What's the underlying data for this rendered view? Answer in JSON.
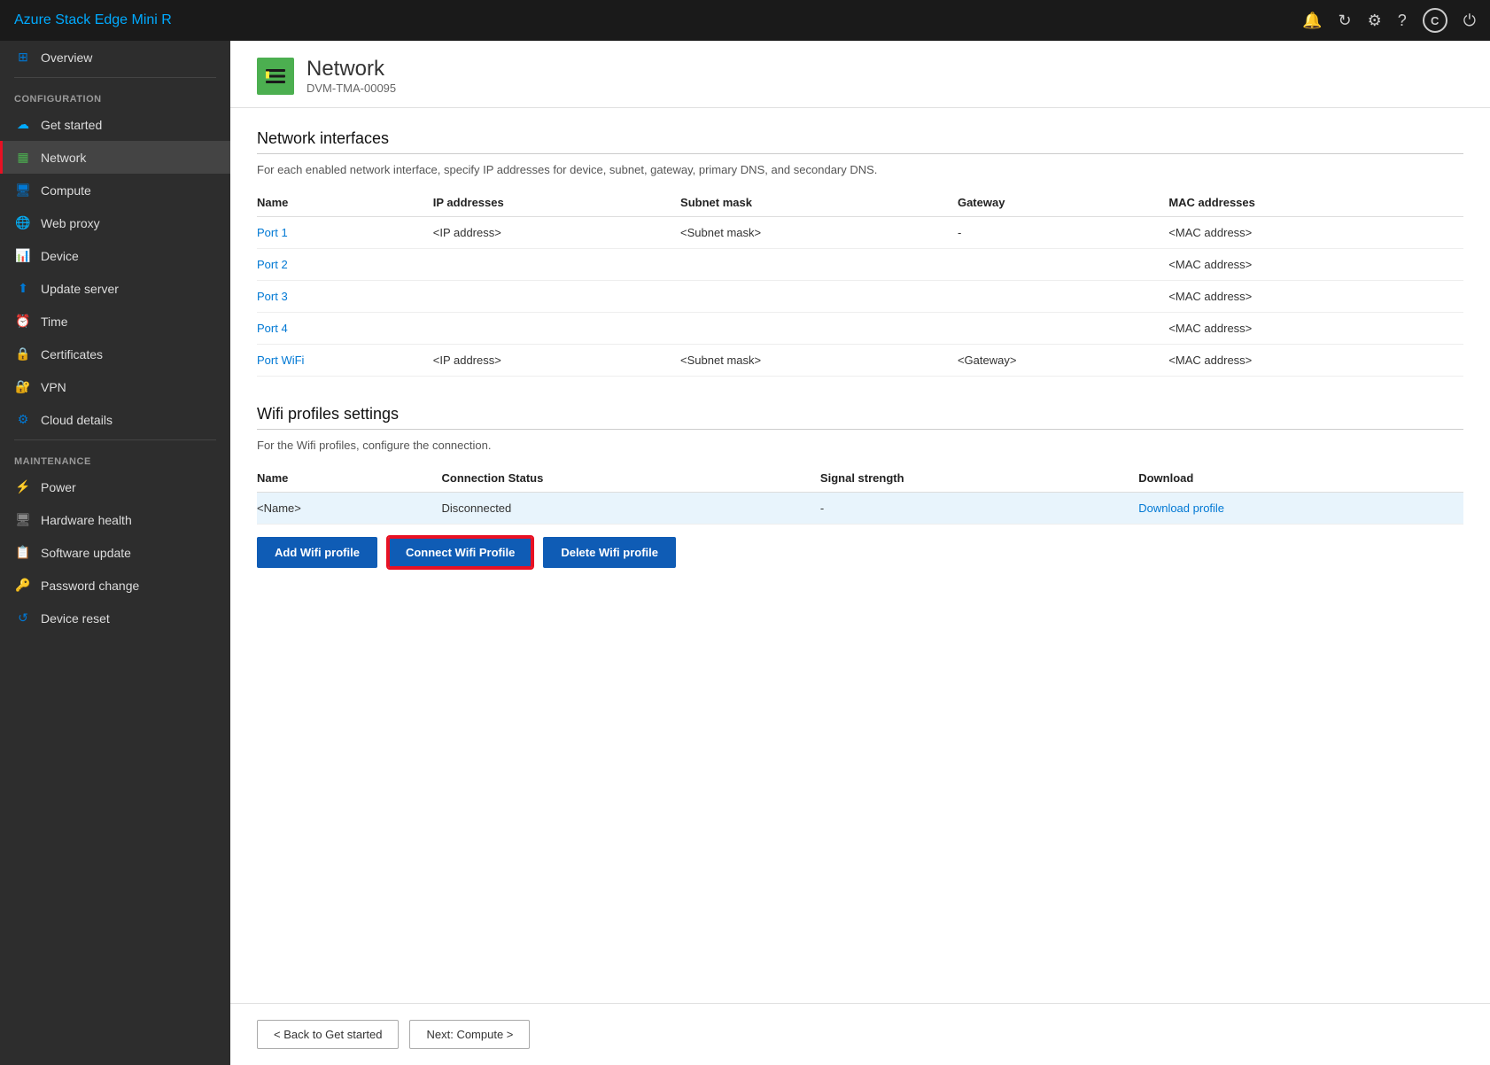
{
  "app": {
    "title": "Azure Stack Edge Mini R"
  },
  "topbar": {
    "icons": [
      "bell",
      "refresh",
      "settings",
      "help",
      "copyright",
      "power"
    ]
  },
  "sidebar": {
    "overview_label": "Overview",
    "config_section": "CONFIGURATION",
    "maintenance_section": "MAINTENANCE",
    "items_config": [
      {
        "id": "get-started",
        "label": "Get started",
        "icon": "☁"
      },
      {
        "id": "network",
        "label": "Network",
        "icon": "▦",
        "active": true
      },
      {
        "id": "compute",
        "label": "Compute",
        "icon": "🖥"
      },
      {
        "id": "web-proxy",
        "label": "Web proxy",
        "icon": "🌐"
      },
      {
        "id": "device",
        "label": "Device",
        "icon": "📊"
      },
      {
        "id": "update-server",
        "label": "Update server",
        "icon": "⬆"
      },
      {
        "id": "time",
        "label": "Time",
        "icon": "⏰"
      },
      {
        "id": "certificates",
        "label": "Certificates",
        "icon": "🔒"
      },
      {
        "id": "vpn",
        "label": "VPN",
        "icon": "🔐"
      },
      {
        "id": "cloud-details",
        "label": "Cloud details",
        "icon": "⚙"
      }
    ],
    "items_maintenance": [
      {
        "id": "power",
        "label": "Power",
        "icon": "⚡"
      },
      {
        "id": "hardware-health",
        "label": "Hardware health",
        "icon": "🖥"
      },
      {
        "id": "software-update",
        "label": "Software update",
        "icon": "📋"
      },
      {
        "id": "password-change",
        "label": "Password change",
        "icon": "🔑"
      },
      {
        "id": "device-reset",
        "label": "Device reset",
        "icon": "↺"
      }
    ]
  },
  "page": {
    "icon_label": "N",
    "title": "Network",
    "subtitle": "DVM-TMA-00095"
  },
  "network_interfaces": {
    "section_title": "Network interfaces",
    "description": "For each enabled network interface, specify IP addresses for device, subnet, gateway, primary DNS, and secondary DNS.",
    "columns": [
      "Name",
      "IP addresses",
      "Subnet mask",
      "Gateway",
      "MAC addresses"
    ],
    "rows": [
      {
        "name": "Port 1",
        "ip": "<IP address>",
        "subnet": "<Subnet mask>",
        "gateway": "-",
        "mac": "<MAC address>",
        "link": true
      },
      {
        "name": "Port 2",
        "ip": "",
        "subnet": "",
        "gateway": "",
        "mac": "<MAC address>",
        "link": true
      },
      {
        "name": "Port 3",
        "ip": "",
        "subnet": "",
        "gateway": "",
        "mac": "<MAC address>",
        "link": true
      },
      {
        "name": "Port 4",
        "ip": "",
        "subnet": "",
        "gateway": "",
        "mac": "<MAC address>",
        "link": true
      },
      {
        "name": "Port WiFi",
        "ip": "<IP address>",
        "subnet": "<Subnet mask>",
        "gateway": "<Gateway>",
        "mac": "<MAC address>",
        "link": true
      }
    ]
  },
  "wifi_profiles": {
    "section_title": "Wifi profiles settings",
    "description": "For the Wifi profiles, configure the connection.",
    "columns": [
      "Name",
      "Connection Status",
      "Signal strength",
      "Download"
    ],
    "rows": [
      {
        "name": "<Name>",
        "status": "Disconnected",
        "signal": "-",
        "download": "Download profile"
      }
    ],
    "buttons": {
      "add": "Add Wifi profile",
      "connect": "Connect Wifi Profile",
      "delete": "Delete Wifi profile"
    }
  },
  "bottom_nav": {
    "back": "< Back to Get started",
    "next": "Next: Compute >"
  }
}
